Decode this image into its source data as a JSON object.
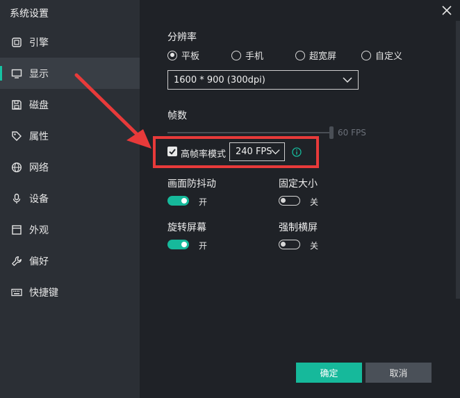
{
  "window": {
    "title": "系统设置"
  },
  "sidebar": {
    "items": [
      {
        "label": "引擎",
        "icon": "engine-icon"
      },
      {
        "label": "显示",
        "icon": "display-icon",
        "active": true
      },
      {
        "label": "磁盘",
        "icon": "disk-icon"
      },
      {
        "label": "属性",
        "icon": "tag-icon"
      },
      {
        "label": "网络",
        "icon": "globe-icon"
      },
      {
        "label": "设备",
        "icon": "microphone-icon"
      },
      {
        "label": "外观",
        "icon": "window-icon"
      },
      {
        "label": "偏好",
        "icon": "wrench-icon"
      },
      {
        "label": "快捷键",
        "icon": "keyboard-icon"
      }
    ]
  },
  "display": {
    "resolution_label": "分辨率",
    "modes": [
      {
        "label": "平板",
        "checked": true
      },
      {
        "label": "手机",
        "checked": false
      },
      {
        "label": "超宽屏",
        "checked": false
      },
      {
        "label": "自定义",
        "checked": false
      }
    ],
    "resolution_value": "1600 * 900 (300dpi)",
    "fps_label": "帧数",
    "fps_slider_value": "60 FPS",
    "high_fps": {
      "label": "高帧率模式",
      "checked": true,
      "value": "240 FPS"
    },
    "toggles": [
      {
        "label": "画面防抖动",
        "state": "开",
        "on": true
      },
      {
        "label": "固定大小",
        "state": "关",
        "on": false
      },
      {
        "label": "旋转屏幕",
        "state": "开",
        "on": true
      },
      {
        "label": "强制横屏",
        "state": "关",
        "on": false
      }
    ]
  },
  "footer": {
    "ok_label": "确定",
    "cancel_label": "取消"
  },
  "colors": {
    "accent": "#16b99b",
    "highlight": "#e83a3a",
    "sidebar_bg": "#2b2f35",
    "content_bg": "#1f2227"
  }
}
